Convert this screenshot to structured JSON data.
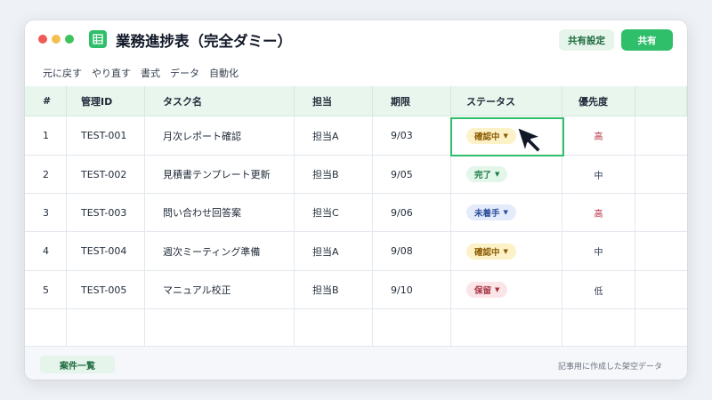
{
  "window": {
    "title": "業務進捗表（完全ダミー）",
    "app_icon": "spreadsheet-icon",
    "buttons": {
      "share_settings": "共有設定",
      "share": "共有"
    }
  },
  "menu": [
    "元に戻す",
    "やり直す",
    "書式",
    "データ",
    "自動化"
  ],
  "table": {
    "headers": [
      "#",
      "管理ID",
      "タスク名",
      "担当",
      "期限",
      "ステータス",
      "優先度"
    ],
    "rows": [
      {
        "num": "1",
        "id": "TEST-001",
        "task": "月次レポート確認",
        "owner": "担当A",
        "due": "9/03",
        "status": "確認中",
        "priority": "高"
      },
      {
        "num": "2",
        "id": "TEST-002",
        "task": "見積書テンプレート更新",
        "owner": "担当B",
        "due": "9/05",
        "status": "完了",
        "priority": "中"
      },
      {
        "num": "3",
        "id": "TEST-003",
        "task": "問い合わせ回答案",
        "owner": "担当C",
        "due": "9/06",
        "status": "未着手",
        "priority": "高"
      },
      {
        "num": "4",
        "id": "TEST-004",
        "task": "週次ミーティング準備",
        "owner": "担当A",
        "due": "9/08",
        "status": "確認中",
        "priority": "中"
      },
      {
        "num": "5",
        "id": "TEST-005",
        "task": "マニュアル校正",
        "owner": "担当B",
        "due": "9/10",
        "status": "保留",
        "priority": "低"
      }
    ]
  },
  "status_colors": {
    "確認中": {
      "bg": "#fdf1c7",
      "fg": "#8a5a00"
    },
    "完了": {
      "bg": "#e3f6ea",
      "fg": "#1d7a45"
    },
    "未着手": {
      "bg": "#e4ecfb",
      "fg": "#2b4f9a"
    },
    "保留": {
      "bg": "#fbe5e8",
      "fg": "#a3323f"
    }
  },
  "priority_colors": {
    "高": "#b3263a",
    "中": "#2d3b55",
    "低": "#374151"
  },
  "accent": "#2fbf6a",
  "footer": {
    "sheet_tab": "案件一覧",
    "note": "記事用に作成した架空データ"
  }
}
